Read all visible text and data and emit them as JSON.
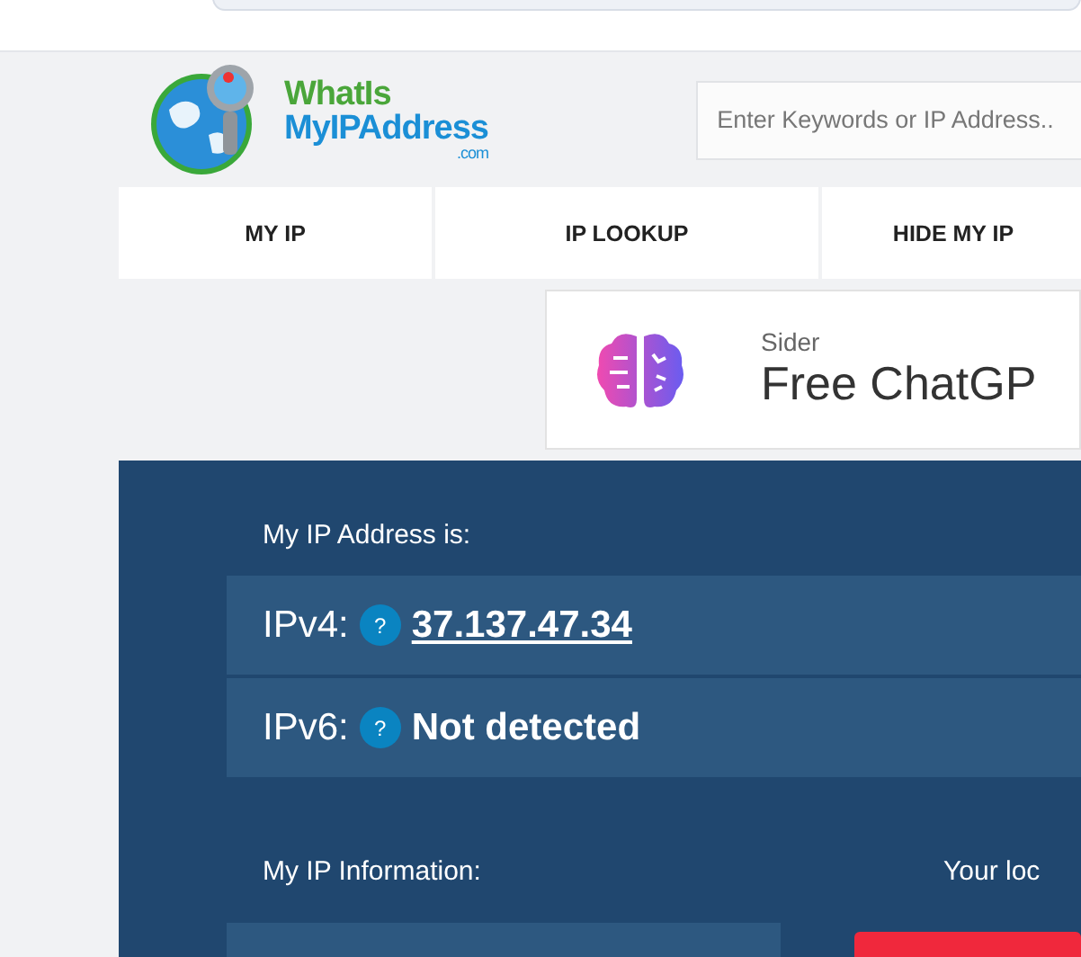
{
  "logo": {
    "line_1": "WhatIs",
    "line_2": "MyIPAddress",
    "line_3": ".com"
  },
  "search": {
    "placeholder": "Enter Keywords or IP Address.."
  },
  "nav": [
    {
      "label": "MY IP"
    },
    {
      "label": "IP LOOKUP"
    },
    {
      "label": "HIDE MY IP"
    }
  ],
  "ad": {
    "brand": "Sider",
    "headline": "Free ChatGP"
  },
  "ip_panel": {
    "heading": "My IP Address is:",
    "rows": [
      {
        "label": "IPv4:",
        "help": "?",
        "value": "37.137.47.34",
        "kind": "link"
      },
      {
        "label": "IPv6:",
        "help": "?",
        "value": "Not detected",
        "kind": "plain"
      }
    ],
    "info_heading": "My IP Information:",
    "location_heading": "Your loc"
  }
}
